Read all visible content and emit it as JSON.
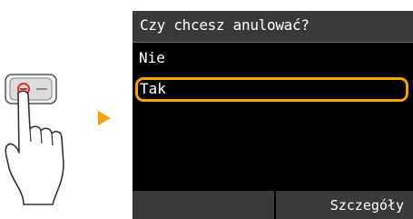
{
  "dialog": {
    "title": "Czy chcesz anulować?",
    "options": [
      {
        "label": "Nie",
        "selected": false
      },
      {
        "label": "Tak",
        "selected": true
      }
    ]
  },
  "footer": {
    "details_label": "Szczegóły"
  },
  "illustration": {
    "icon": "hand-pressing-stop-button-icon",
    "arrow_icon": "arrow-right-icon"
  },
  "colors": {
    "screen_bg": "#000000",
    "bar_bg": "#3a3a3a",
    "highlight": "#f4a300",
    "text": "#ffffff"
  }
}
